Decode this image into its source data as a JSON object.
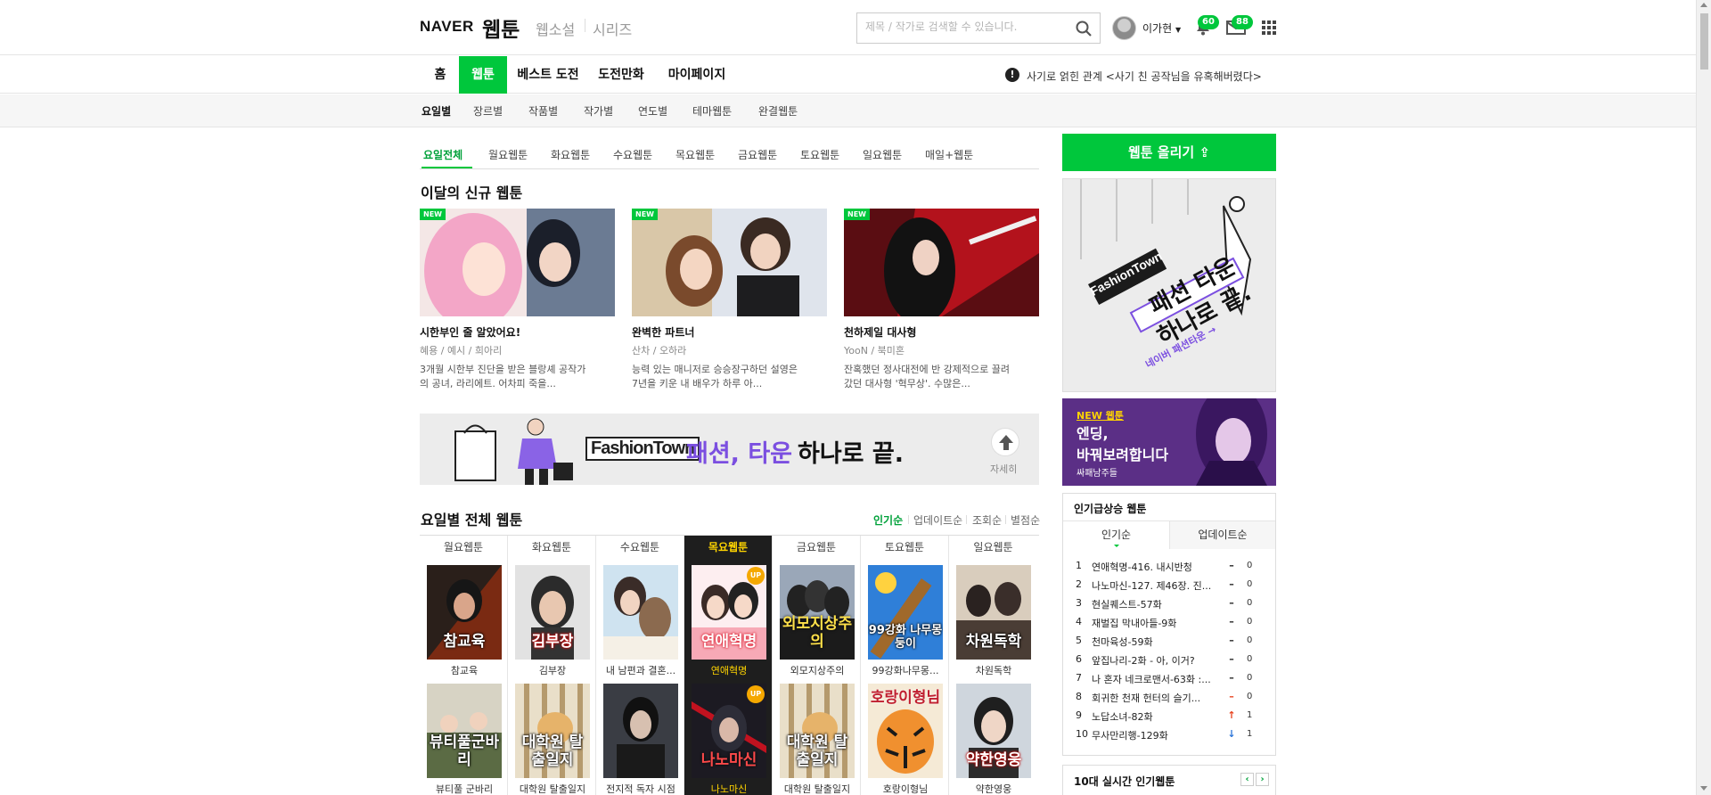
{
  "header": {
    "logo_naver": "NAVER",
    "logo_webtoon": "웹툰",
    "services": [
      "웹소설",
      "시리즈"
    ],
    "search_placeholder": "제목 / 작가로 검색할 수 있습니다.",
    "user_name": "이가현",
    "notif_count": "60",
    "mail_count": "88"
  },
  "gnb": {
    "items": [
      "홈",
      "웹툰",
      "베스트 도전",
      "도전만화",
      "마이페이지"
    ],
    "notice": "사기로 얽힌 관계 <사기 친 공작님을 유혹해버렸다>"
  },
  "lnb": {
    "items": [
      "요일별",
      "장르별",
      "작품별",
      "작가별",
      "연도별",
      "테마웹툰",
      "완결웹툰"
    ]
  },
  "day_tabs": [
    "요일전체",
    "월요웹툰",
    "화요웹툰",
    "수요웹툰",
    "목요웹툰",
    "금요웹툰",
    "토요웹툰",
    "일요웹툰",
    "매일+웹툰"
  ],
  "new_section": {
    "title": "이달의 신규 웹툰",
    "badge": "NEW",
    "cards": [
      {
        "title": "시한부인 줄 알았어요!",
        "author": "혜용 / 예시 / 희아리",
        "desc": [
          "3개월 시한부 진단을 받은 블랑셰 공작가",
          "의 공녀, 라리에트. 어차피 죽을..."
        ]
      },
      {
        "title": "완벽한 파트너",
        "author": "산차 / 오하라",
        "desc": [
          "능력 있는 매니저로 승승장구하던 설영은",
          "7년을 키운 내 배우가 하루 아..."
        ]
      },
      {
        "title": "천하제일 대사형",
        "author": "YooN / 북미혼",
        "desc": [
          "잔혹했던 정사대전에 반 강제적으로 끌려",
          "갔던 대사형 '혁무상'. 수많은..."
        ]
      }
    ]
  },
  "banner": {
    "logo": "FashionTown",
    "purple": "패션, 타운",
    "black": "하나로 끝.",
    "more": "자세히"
  },
  "week_section": {
    "title": "요일별 전체 웹툰",
    "sorts": [
      "인기순",
      "업데이트순",
      "조회순",
      "별점순"
    ],
    "up_label": "UP",
    "columns": [
      {
        "day": "월요웹툰",
        "items": [
          {
            "title": "참교육",
            "cap": "참교육"
          },
          {
            "title": "뷰티풀 군바리",
            "cap": "뷰티풀군바리"
          }
        ]
      },
      {
        "day": "화요웹툰",
        "items": [
          {
            "title": "김부장",
            "cap": "김부장"
          },
          {
            "title": "대학원 탈출일지",
            "cap": "대학원 탈출일지"
          }
        ]
      },
      {
        "day": "수요웹툰",
        "items": [
          {
            "title": "내 남편과 결혼...",
            "cap": ""
          },
          {
            "title": "전지적 독자 시점",
            "cap": ""
          }
        ]
      },
      {
        "day": "목요웹툰",
        "items": [
          {
            "title": "연애혁명",
            "cap": "연애혁명"
          },
          {
            "title": "나노마신",
            "cap": "나노마신"
          }
        ]
      },
      {
        "day": "금요웹툰",
        "items": [
          {
            "title": "외모지상주의",
            "cap": "외모지상주의"
          },
          {
            "title": "대학원 탈출일지",
            "cap": "대학원 탈출일지"
          }
        ]
      },
      {
        "day": "토요웹툰",
        "items": [
          {
            "title": "99강화나무몽...",
            "cap": "99강화 나무몽둥이"
          },
          {
            "title": "호랑이형님",
            "cap": "호랑이형님"
          }
        ]
      },
      {
        "day": "일요웹툰",
        "items": [
          {
            "title": "차원독학",
            "cap": "차원독학"
          },
          {
            "title": "약한영웅",
            "cap": "약한영웅"
          }
        ]
      }
    ]
  },
  "sidebar": {
    "upload": "웹툰 올리기",
    "ad1": {
      "logo": "FashionTown",
      "line1": "패션 타운",
      "line2": "하나로 끝.",
      "tag": "네이버 패션타운 →"
    },
    "ad2": {
      "tag": "NEW 웹툰",
      "line1": "엔딩,",
      "line2": "바꿔보려합니다",
      "author": "싸패남주들"
    },
    "rank": {
      "title": "인기급상승 웹툰",
      "tabs": [
        "인기순",
        "업데이트순"
      ],
      "rows": [
        {
          "rank": "1",
          "title": "연애혁명-416. 내시반청",
          "change": "–",
          "value": "0",
          "dir": "same"
        },
        {
          "rank": "2",
          "title": "나노마신-127. 제46장. 진...",
          "change": "–",
          "value": "0",
          "dir": "same"
        },
        {
          "rank": "3",
          "title": "현실퀘스트-57화",
          "change": "–",
          "value": "0",
          "dir": "same"
        },
        {
          "rank": "4",
          "title": "재벌집 막내아들-9화",
          "change": "–",
          "value": "0",
          "dir": "same"
        },
        {
          "rank": "5",
          "title": "천마육성-59화",
          "change": "–",
          "value": "0",
          "dir": "same"
        },
        {
          "rank": "6",
          "title": "앞집나리-2화 - 아, 이거?",
          "change": "–",
          "value": "0",
          "dir": "same"
        },
        {
          "rank": "7",
          "title": "나 혼자 네크로맨서-63화 :...",
          "change": "–",
          "value": "0",
          "dir": "same"
        },
        {
          "rank": "8",
          "title": "회귀한 천재 헌터의 슬기...",
          "change": "–",
          "value": "0",
          "dir": "down-red"
        },
        {
          "rank": "9",
          "title": "노답소녀-82화",
          "change": "↑",
          "value": "1",
          "dir": "up"
        },
        {
          "rank": "10",
          "title": "무사만리행-129화",
          "change": "↓",
          "value": "1",
          "dir": "down"
        }
      ]
    },
    "rank2_title": "10대 실시간 인기웹툰"
  },
  "colors": {
    "accent": "#00c73c",
    "selected_day_bg": "#1e1e1e",
    "selected_day_text": "#ffd400",
    "banner_purple": "#7b4fe0",
    "up_arrow": "#e8431f",
    "down_arrow": "#2b74d8"
  }
}
